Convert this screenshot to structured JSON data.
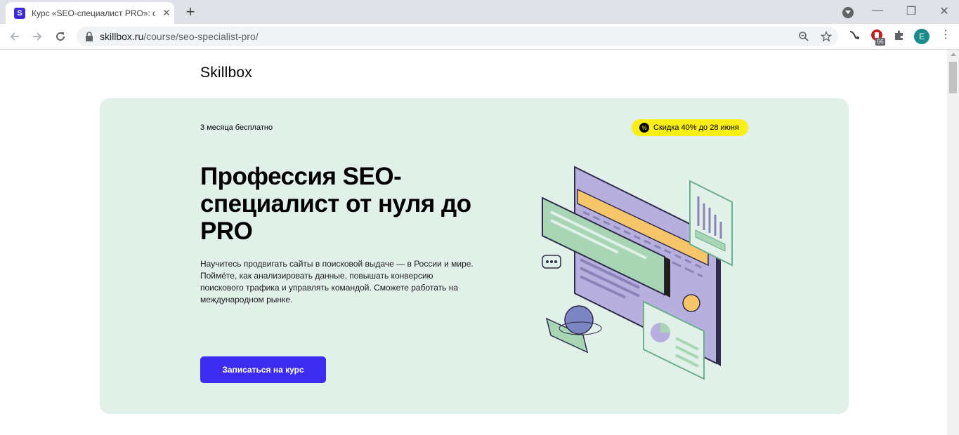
{
  "browser": {
    "tab": {
      "favicon_letter": "S",
      "title": "Курс «SEO-специалист PRO»: об",
      "close_glyph": "✕"
    },
    "new_tab_glyph": "+",
    "window_controls": {
      "minimize": "—",
      "restore": "❐",
      "close": "✕"
    },
    "address_bar": {
      "host": "skillbox.ru",
      "path": "/course/seo-specialist-pro/"
    },
    "extension_badge": "66",
    "profile_initial": "E",
    "menu_glyph": "⋮",
    "icons": [
      "back-icon",
      "forward-icon",
      "reload-icon",
      "lock-icon",
      "zoom-icon",
      "star-icon",
      "extension-icon",
      "extension-badge-icon",
      "puzzle-icon"
    ]
  },
  "page": {
    "logo": "Skillbox",
    "promo_left": "3 месяца бесплатно",
    "discount_badge": {
      "icon_glyph": "%",
      "text": "Скидка 40% до 28 июня"
    },
    "title": "Профессия SEO-специалист от нуля до PRO",
    "description": "Научитесь продвигать сайты в поисковой выдаче — в России и мире. Поймёте, как анализировать данные, повышать конверсию поискового трафика и управлять командой. Сможете работать на международном рынке.",
    "cta_label": "Записаться на курс",
    "colors": {
      "hero_bg": "#e2f0ea",
      "badge_bg": "#f9ee16",
      "cta_bg": "#3d2bf0",
      "illustration_purple": "#b7b0df",
      "illustration_green": "#a8d5b4",
      "illustration_orange": "#f7c66b"
    }
  }
}
